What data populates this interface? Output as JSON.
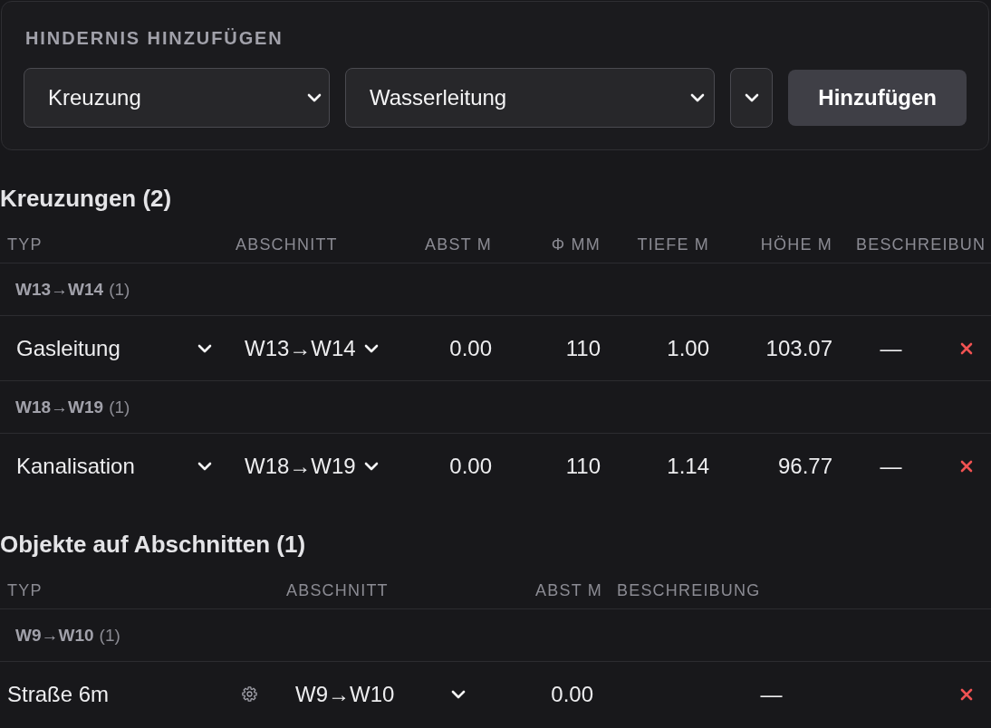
{
  "add_obstacle": {
    "title": "HINDERNIS HINZUFÜGEN",
    "selects": [
      {
        "kind": "wide",
        "value": "Kreuzung"
      },
      {
        "kind": "wide",
        "value": "Wasserleitung"
      },
      {
        "kind": "compact"
      }
    ],
    "add_button": "Hinzufügen"
  },
  "crossings": {
    "title": "Kreuzungen (2)",
    "columns": [
      "TYP",
      "ABSCHNITT",
      "ABST M",
      "Φ MM",
      "TIEFE M",
      "HÖHE M",
      "BESCHREIBUN"
    ],
    "groups": [
      {
        "section": "W13→W14",
        "count": "(1)",
        "rows": [
          {
            "type": "Gasleitung",
            "section": "W13→W14",
            "abst_m": "0.00",
            "diameter_mm": "110",
            "tiefe_m": "1.00",
            "hoehe_m": "103.07",
            "beschreibung": "—"
          }
        ]
      },
      {
        "section": "W18→W19",
        "count": "(1)",
        "rows": [
          {
            "type": "Kanalisation",
            "section": "W18→W19",
            "abst_m": "0.00",
            "diameter_mm": "110",
            "tiefe_m": "1.14",
            "hoehe_m": "96.77",
            "beschreibung": "—"
          }
        ]
      }
    ]
  },
  "section_objects": {
    "title": "Objekte auf Abschnitten (1)",
    "columns": [
      "TYP",
      "ABSCHNITT",
      "ABST M",
      "BESCHREIBUNG"
    ],
    "groups": [
      {
        "section": "W9→W10",
        "count": "(1)",
        "rows": [
          {
            "type": "Straße 6m",
            "section": "W9→W10",
            "abst_m": "0.00",
            "beschreibung": "—"
          }
        ]
      }
    ]
  }
}
